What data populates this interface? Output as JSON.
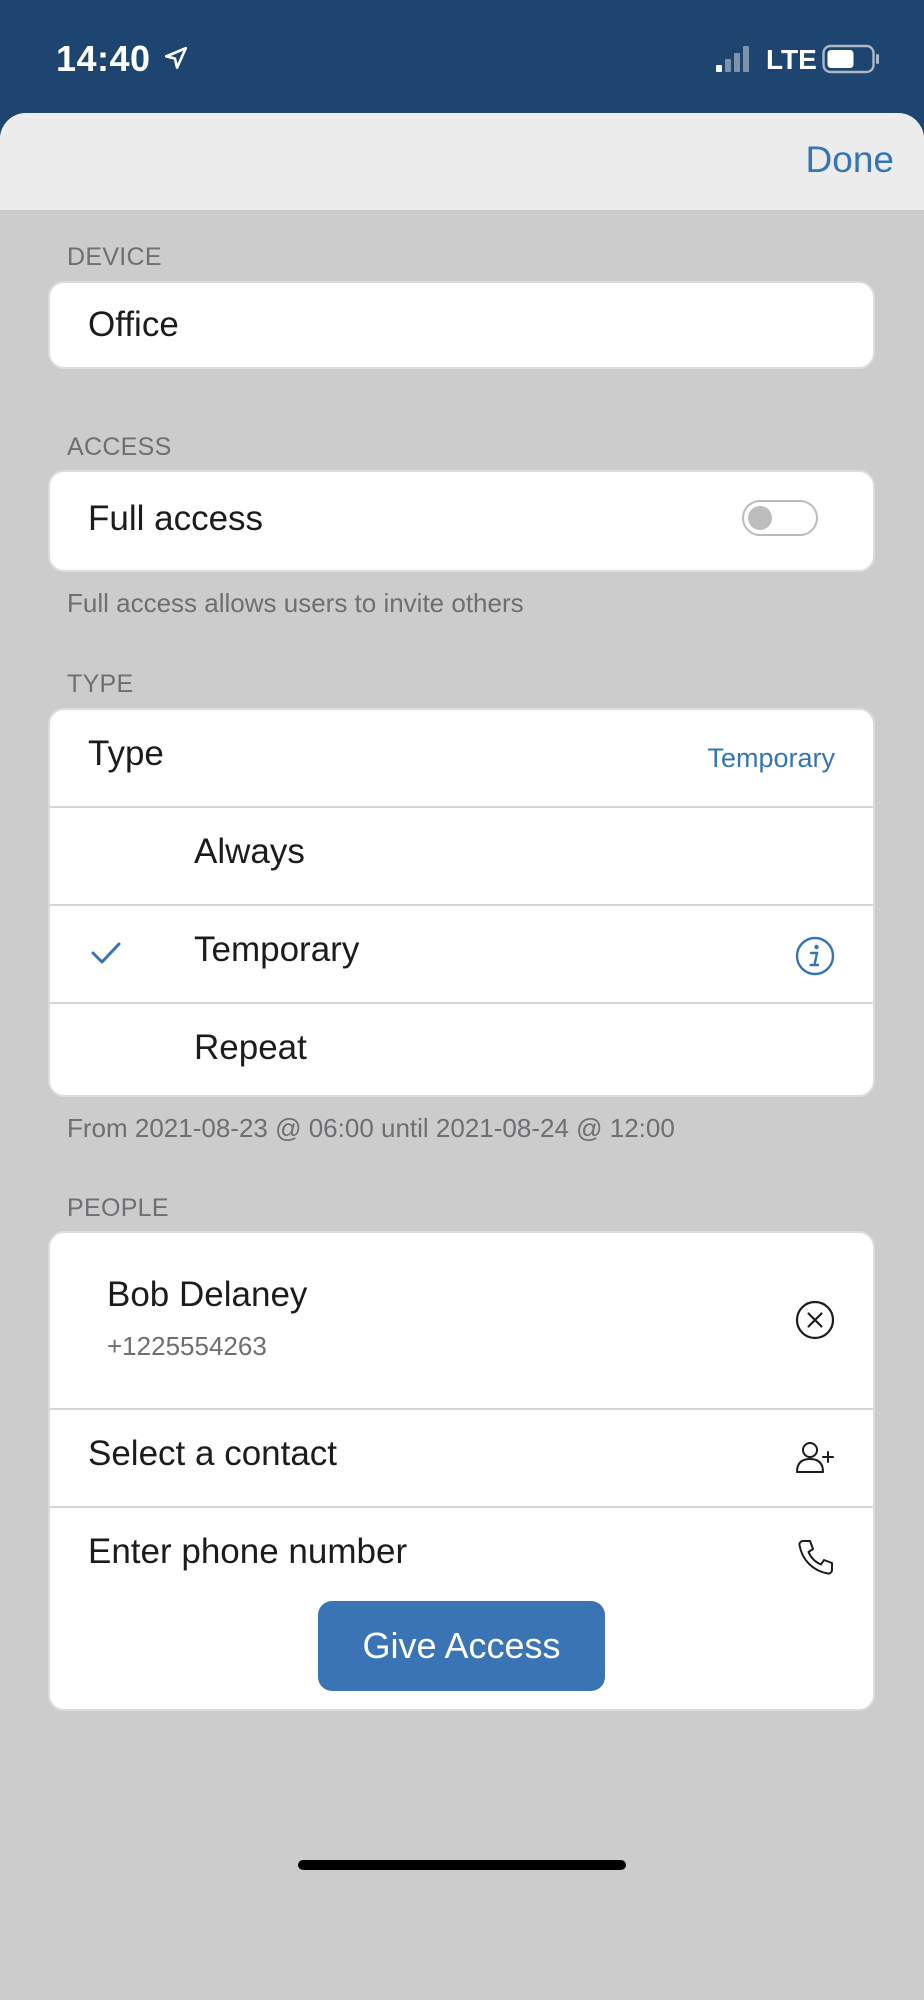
{
  "status_bar": {
    "time": "14:40",
    "network": "LTE",
    "icons": [
      "location-arrow-icon",
      "signal-icon",
      "battery-icon"
    ]
  },
  "nav": {
    "done_label": "Done"
  },
  "device": {
    "header": "DEVICE",
    "value": "Office"
  },
  "access": {
    "header": "ACCESS",
    "full_access_label": "Full access",
    "full_access_enabled": false,
    "footnote": "Full access allows users to invite others"
  },
  "type": {
    "header": "TYPE",
    "label": "Type",
    "selected": "Temporary",
    "options": [
      {
        "label": "Always",
        "checked": false
      },
      {
        "label": "Temporary",
        "checked": true,
        "icon": "info-icon"
      },
      {
        "label": "Repeat",
        "checked": false
      }
    ],
    "footnote": "From 2021-08-23 @ 06:00 until 2021-08-24 @ 12:00"
  },
  "people": {
    "header": "PEOPLE",
    "entries": [
      {
        "name": "Bob Delaney",
        "phone": "+1225554263"
      }
    ],
    "select_contact_label": "Select a contact",
    "enter_phone_label": "Enter phone number"
  },
  "actions": {
    "give_access_label": "Give Access"
  },
  "colors": {
    "accent": "#3675b5",
    "status_bar": "#1e4470",
    "sheet_bg": "#cccccc",
    "button": "#3a74b4"
  }
}
